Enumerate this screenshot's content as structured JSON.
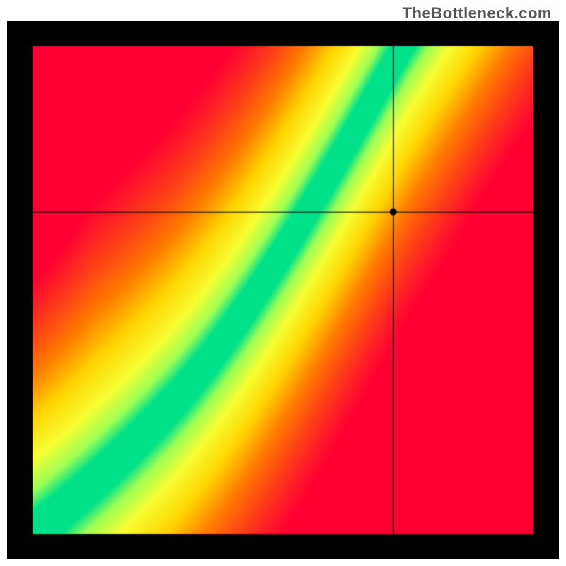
{
  "watermark": "TheBottleneck.com",
  "chart_data": {
    "type": "heatmap",
    "title": "",
    "xlabel": "",
    "ylabel": "",
    "xlim": [
      0,
      100
    ],
    "ylim": [
      0,
      100
    ],
    "crosshair": {
      "x": 72,
      "y": 66
    },
    "colorscale": {
      "stops": [
        {
          "t": 0.0,
          "color": "#ff0033"
        },
        {
          "t": 0.35,
          "color": "#ff7a00"
        },
        {
          "t": 0.55,
          "color": "#ffd400"
        },
        {
          "t": 0.75,
          "color": "#f8ff33"
        },
        {
          "t": 0.9,
          "color": "#9eff55"
        },
        {
          "t": 1.0,
          "color": "#00e28a"
        }
      ]
    },
    "frame": {
      "margin_pct": 4.6
    },
    "optimal_curve": {
      "description": "Optimal GPU% as a function of CPU% (origin lower-left). The green band follows this curve with a narrow tolerance.",
      "points": [
        {
          "x": 0,
          "y": 0
        },
        {
          "x": 10,
          "y": 8
        },
        {
          "x": 20,
          "y": 18
        },
        {
          "x": 30,
          "y": 30
        },
        {
          "x": 40,
          "y": 45
        },
        {
          "x": 50,
          "y": 60
        },
        {
          "x": 60,
          "y": 76
        },
        {
          "x": 70,
          "y": 92
        },
        {
          "x": 75,
          "y": 100
        }
      ],
      "band_halfwidth_pct": 4.5,
      "start_slope": 0.8,
      "mid_slope": 1.6,
      "accel": 0.011
    },
    "marker": {
      "radius_px": 5
    }
  }
}
